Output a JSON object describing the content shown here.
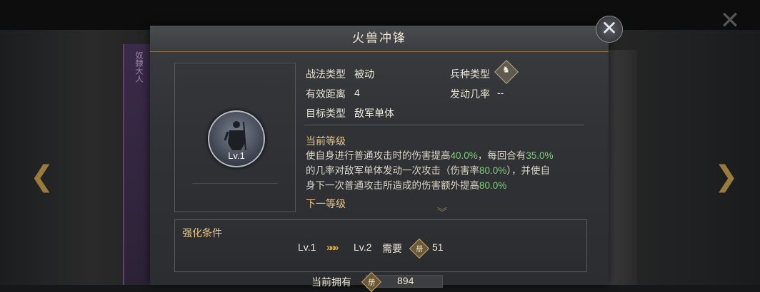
{
  "background": {
    "left_card_text": "奴隷大人",
    "left_arrow": "❮",
    "right_arrow": "❯",
    "close_glyph": "✕"
  },
  "dialog": {
    "title": "火兽冲锋",
    "close_glyph": "✕"
  },
  "portrait": {
    "level": "Lv.1"
  },
  "info": {
    "tactic_type_label": "战法类型",
    "tactic_type_value": "被动",
    "troop_type_label": "兵种类型",
    "troop_icon_glyph": "♞",
    "range_label": "有效距离",
    "range_value": "4",
    "trigger_rate_label": "发动几率",
    "trigger_rate_value": "--",
    "target_label": "目标类型",
    "target_value": "敌军单体"
  },
  "current_level": {
    "title": "当前等级",
    "desc": {
      "line1_a": "使自身进行普通攻击时的伤害提高",
      "line1_b": "40.0%",
      "line1_c": "，每回合有",
      "line1_d": "35.0%",
      "line2_a": "的几率对敌军单体发动一次攻击（伤害率",
      "line2_b": "80.0%",
      "line2_c": "），并使自",
      "line3_a": "身下一次普通攻击所造成的伤害额外提高",
      "line3_b": "80.0%"
    }
  },
  "next_level": {
    "title": "下一等级",
    "scroll_glyph": "︾"
  },
  "enhance": {
    "title": "强化条件",
    "from_level": "Lv.1",
    "arrows": "»»»",
    "to_level": "Lv.2",
    "need_label": "需要",
    "book_glyph": "册",
    "need_count": "51"
  },
  "own": {
    "label": "当前拥有",
    "book_glyph": "册",
    "count": "894"
  },
  "colors": {
    "accent_gold": "#e8c88a",
    "highlight_green": "#7fd07a",
    "arrow_gold": "#d9a64a"
  }
}
